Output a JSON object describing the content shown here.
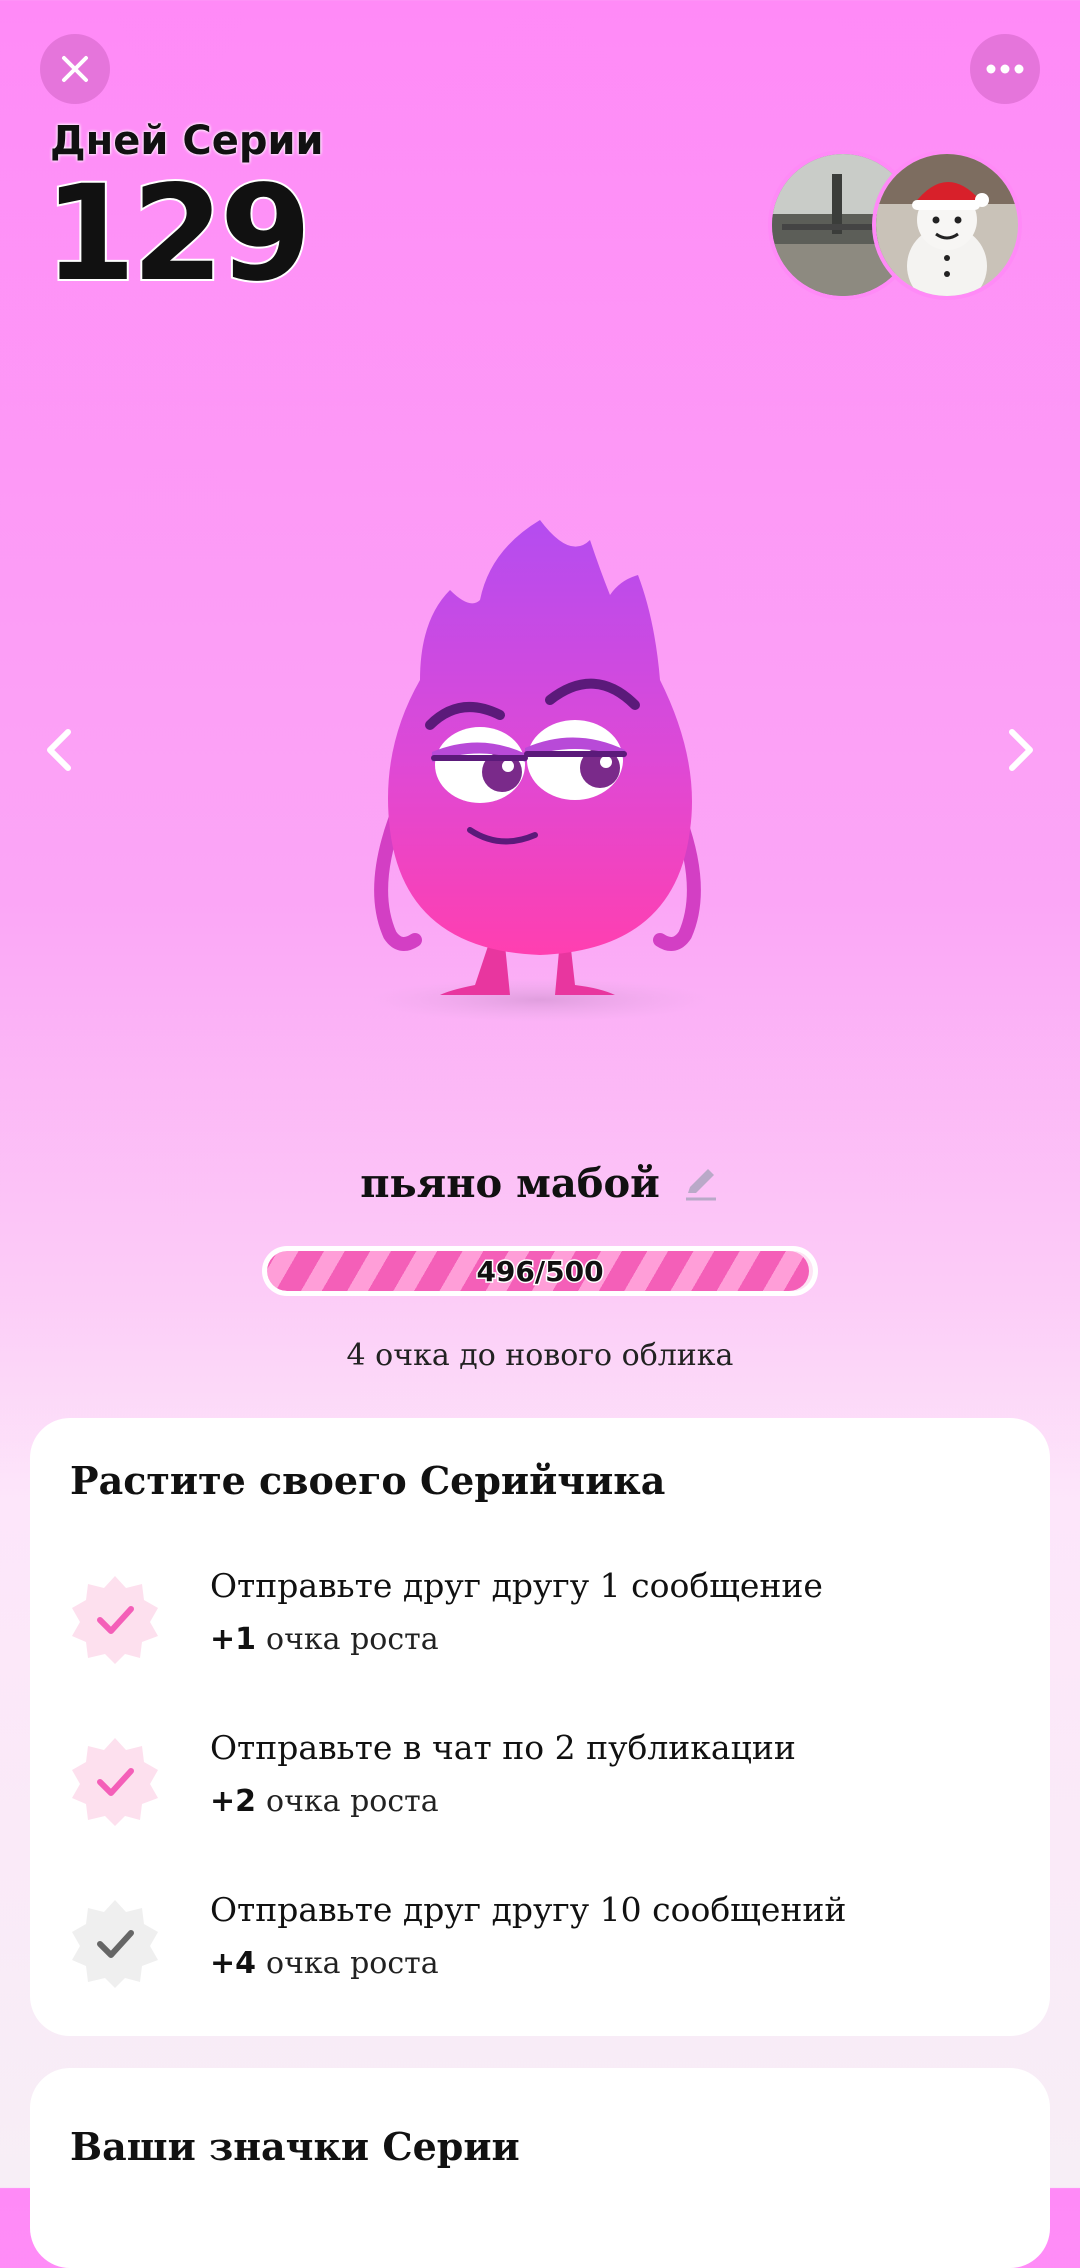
{
  "header": {
    "close_icon": "close-icon",
    "more_icon": "more-dots-icon",
    "streak_label": "Дней Серии",
    "streak_count": "129"
  },
  "avatars": [
    {
      "name": "friend-photo-avatar"
    },
    {
      "name": "snowman-photo-avatar"
    }
  ],
  "mascot": {
    "name": "пьяно мабой",
    "edit_icon": "pencil-icon",
    "progress_text": "496/500",
    "progress_value": 496,
    "progress_max": 500,
    "points_left": "4 очка до нового облика",
    "color_top": "#b44cf0",
    "color_bottom": "#ff3fb0"
  },
  "tasks_card": {
    "title": "Растите своего Серийчика",
    "tasks": [
      {
        "title": "Отправьте друг другу 1 сообщение",
        "points": "+1",
        "points_label": "очка роста",
        "done": true
      },
      {
        "title": "Отправьте в чат по 2 публикации",
        "points": "+2",
        "points_label": "очка роста",
        "done": true
      },
      {
        "title": "Отправьте друг другу 10 сообщений",
        "points": "+4",
        "points_label": "очка роста",
        "done": false
      }
    ]
  },
  "badges_card": {
    "title": "Ваши значки Серии"
  },
  "colors": {
    "accent_pink": "#f45fb8",
    "done_badge": "#fde0ee",
    "pending_badge": "#efefef"
  }
}
